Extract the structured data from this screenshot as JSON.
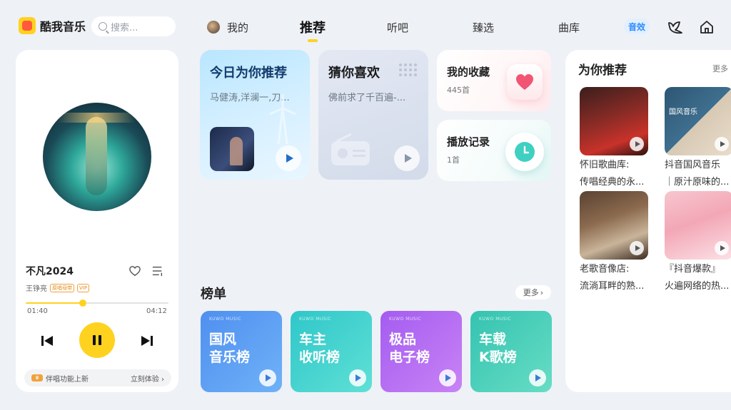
{
  "app": {
    "name": "酷我音乐"
  },
  "search": {
    "placeholder": "搜索..."
  },
  "nav": {
    "mine": "我的",
    "recommend": "推荐",
    "tingba": "听吧",
    "zhenxuan": "臻选",
    "quku": "曲库",
    "sound_effect": "音效"
  },
  "player": {
    "song": "不凡2024",
    "artist": "王铮亮",
    "tags": [
      "原唱母带",
      "VIP"
    ],
    "current_time": "01:40",
    "total_time": "04:12",
    "progress": 0.4,
    "feature_text": "伴唱功能上新",
    "feature_action": "立刻体验"
  },
  "cards": {
    "today": {
      "title": "今日为你推荐",
      "subtitle": "马健涛,洋澜一,刀..."
    },
    "guess": {
      "title": "猜你喜欢",
      "subtitle": "佛前求了千百遍-..."
    },
    "favorites": {
      "title": "我的收藏",
      "count": "445首"
    },
    "history": {
      "title": "播放记录",
      "count": "1首"
    }
  },
  "charts": {
    "title": "榜单",
    "more": "更多",
    "brand": "KUWO MUSIC",
    "items": [
      {
        "line1": "国风",
        "line2": "音乐榜",
        "from": "#4f8ff0",
        "to": "#6fb2f7"
      },
      {
        "line1": "车主",
        "line2": "收听榜",
        "from": "#2fc7c9",
        "to": "#5fe0d6"
      },
      {
        "line1": "极品",
        "line2": "电子榜",
        "from": "#a45cf0",
        "to": "#c883f5"
      },
      {
        "line1": "车载",
        "line2": "K歌榜",
        "from": "#34c3b1",
        "to": "#67ddc4"
      }
    ]
  },
  "recommend": {
    "title": "为你推荐",
    "more": "更多",
    "items": [
      {
        "line1": "怀旧歌曲库:",
        "line2": "传唱经典的永..."
      },
      {
        "line1": "抖音国风音乐",
        "line2": "｜原汁原味的..."
      },
      {
        "line1": "老歌音像店:",
        "line2": "流淌耳畔的熟..."
      },
      {
        "line1": "『抖音爆款』",
        "line2": "火遍网络的热..."
      }
    ],
    "thumb_label": "国风音乐"
  },
  "colors": {
    "accent": "#ffd21f",
    "background": "#eef1f6"
  }
}
